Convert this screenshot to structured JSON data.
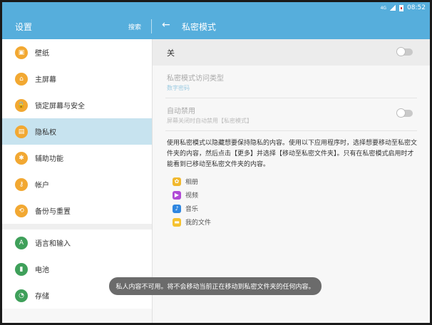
{
  "status_bar": {
    "signal_label": "4G",
    "time": "08:52"
  },
  "app_bar": {
    "left_title": "设置",
    "search_label": "搜索",
    "back_icon": "arrow-left-icon",
    "right_title": "私密模式"
  },
  "sidebar": {
    "groups": [
      [
        {
          "label": "壁纸",
          "icon": "wallpaper-icon",
          "glyph": "▣",
          "color": "#f2a832"
        },
        {
          "label": "主屏幕",
          "icon": "home-icon",
          "glyph": "⌂",
          "color": "#f2a832"
        },
        {
          "label": "锁定屏幕与安全",
          "icon": "lock-icon",
          "glyph": "🔒",
          "color": "#f2a832"
        },
        {
          "label": "隐私权",
          "icon": "privacy-icon",
          "glyph": "▤",
          "color": "#f2a832",
          "active": true
        },
        {
          "label": "辅助功能",
          "icon": "accessibility-icon",
          "glyph": "✱",
          "color": "#f2a832"
        },
        {
          "label": "帐户",
          "icon": "key-icon",
          "glyph": "⚷",
          "color": "#f2a832"
        },
        {
          "label": "备份与重置",
          "icon": "backup-icon",
          "glyph": "⟲",
          "color": "#f2a832"
        }
      ],
      [
        {
          "label": "语言和输入",
          "icon": "language-icon",
          "glyph": "A",
          "color": "#3fa05a"
        },
        {
          "label": "电池",
          "icon": "battery-icon",
          "glyph": "▮",
          "color": "#3fa05a"
        },
        {
          "label": "存储",
          "icon": "storage-icon",
          "glyph": "◔",
          "color": "#3fa05a"
        }
      ]
    ]
  },
  "main": {
    "master_switch_label": "关",
    "access_type_title": "私密模式访问类型",
    "access_type_value": "数字密码",
    "auto_disable_title": "自动禁用",
    "auto_disable_desc": "屏幕关闭时自动禁用【私密模式】",
    "description": "使用私密模式以隐藏想要保持隐私的内容。使用以下应用程序时，选择想要移动至私密文件夹的内容，然后点击【更多】并选择【移动至私密文件夹】。只有在私密模式启用时才能看到已移动至私密文件夹的内容。",
    "apps": [
      {
        "label": "相册",
        "icon": "gallery-icon",
        "glyph": "✿",
        "color": "#f1b82d"
      },
      {
        "label": "视频",
        "icon": "video-icon",
        "glyph": "▶",
        "color": "#b04ad6"
      },
      {
        "label": "音乐",
        "icon": "music-icon",
        "glyph": "♪",
        "color": "#2f86e0"
      },
      {
        "label": "我的文件",
        "icon": "folder-icon",
        "glyph": "▬",
        "color": "#f5c22f"
      }
    ]
  },
  "toast": {
    "message": "私人内容不可用。将不会移动当前正在移动到私密文件夹的任何内容。"
  }
}
